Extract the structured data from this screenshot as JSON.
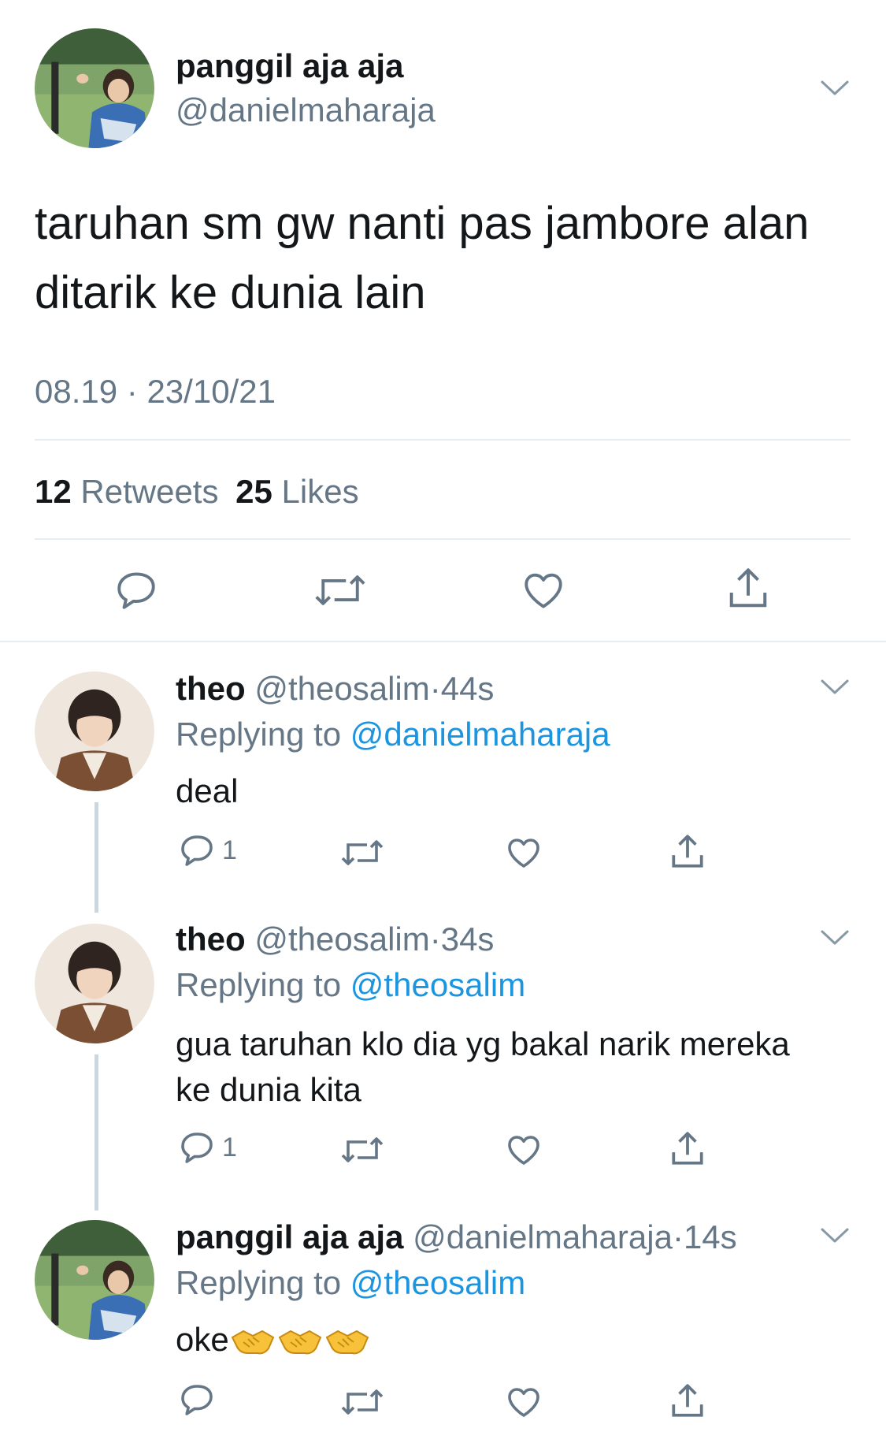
{
  "main_tweet": {
    "display_name": "panggil aja aja",
    "handle": "@danielmaharaja",
    "text_line1": "taruhan sm gw nanti pas jambore alan",
    "text_line2": "ditarik ke dunia lain",
    "time": "08.19",
    "separator": "·",
    "date": "23/10/21",
    "retweets_count": "12",
    "retweets_label": "Retweets",
    "likes_count": "25",
    "likes_label": "Likes"
  },
  "replies": [
    {
      "display_name": "theo",
      "handle": "@theosalim",
      "dot": "·",
      "time": "44s",
      "replying_prefix": "Replying to",
      "replying_to": "@danielmaharaja",
      "text_line1": "deal",
      "text_line2": "",
      "reply_count": "1"
    },
    {
      "display_name": "theo",
      "handle": "@theosalim",
      "dot": "·",
      "time": "34s",
      "replying_prefix": "Replying to",
      "replying_to": "@theosalim",
      "text_line1": "gua taruhan klo dia yg bakal narik mereka",
      "text_line2": "ke dunia kita",
      "reply_count": "1"
    },
    {
      "display_name": "panggil aja aja",
      "handle": "@danielmaharaja",
      "dot": "·",
      "time": "14s",
      "replying_prefix": "Replying to",
      "replying_to": "@theosalim",
      "text_line1": "oke",
      "text_line2": "",
      "reply_count": ""
    }
  ],
  "icons": {
    "reply": "reply-icon",
    "retweet": "retweet-icon",
    "like": "heart-icon",
    "share": "share-icon",
    "menu": "chevron-down-icon",
    "emoji": "handshake-emoji"
  },
  "colors": {
    "text": "#14171a",
    "secondary": "#657786",
    "link": "#1b95e0",
    "divider": "#e6ecf0",
    "thread_line": "#ccd6dd"
  }
}
